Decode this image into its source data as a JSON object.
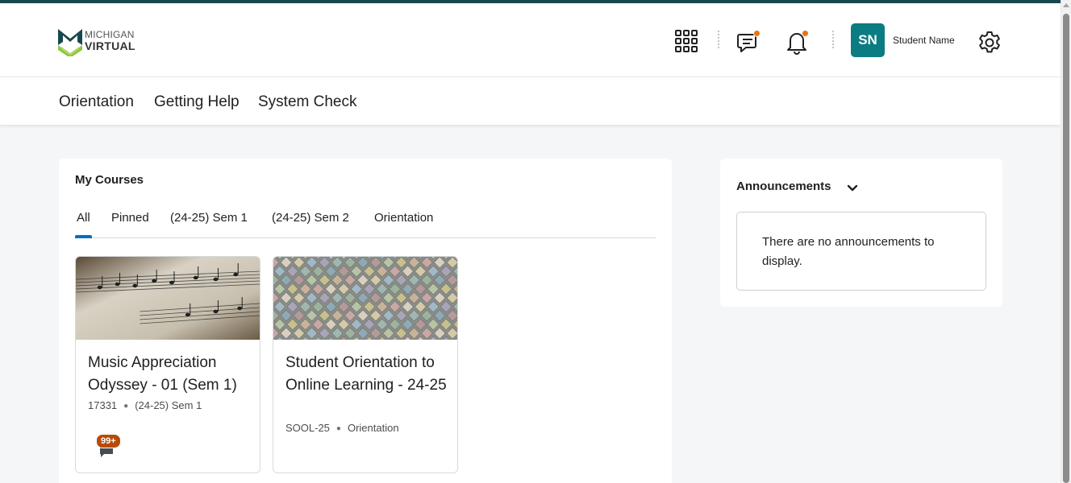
{
  "brand": {
    "logo_line1": "MICHIGAN",
    "logo_line2": "VIRTUAL",
    "color_primary": "#17484f",
    "color_accent": "#8dc63f"
  },
  "header": {
    "apps_icon": "grid-icon",
    "messages_icon": "chat-icon",
    "notifications_icon": "bell-icon",
    "notification_dot_color": "#e87511",
    "avatar_initials": "SN",
    "avatar_color": "#0a7c82",
    "user_name": "Student Name",
    "settings_icon": "gear-icon"
  },
  "nav": {
    "items": [
      "Orientation",
      "Getting Help",
      "System Check"
    ]
  },
  "courses": {
    "title": "My Courses",
    "tabs": [
      "All",
      "Pinned",
      "(24-25) Sem 1",
      "(24-25) Sem 2",
      "Orientation"
    ],
    "active_tab": "All",
    "cards": [
      {
        "title": "Music Appreciation Odyssey - 01 (Sem 1)",
        "code": "17331",
        "semester": "(24-25) Sem 1",
        "badge": "99+",
        "image": "sheet-music"
      },
      {
        "title": "Student Orientation to Online Learning - 24-25",
        "code": "SOOL-25",
        "semester": "Orientation",
        "image": "pastel-tiles"
      }
    ]
  },
  "announcements": {
    "title": "Announcements",
    "empty_text": "There are no announcements to display."
  }
}
